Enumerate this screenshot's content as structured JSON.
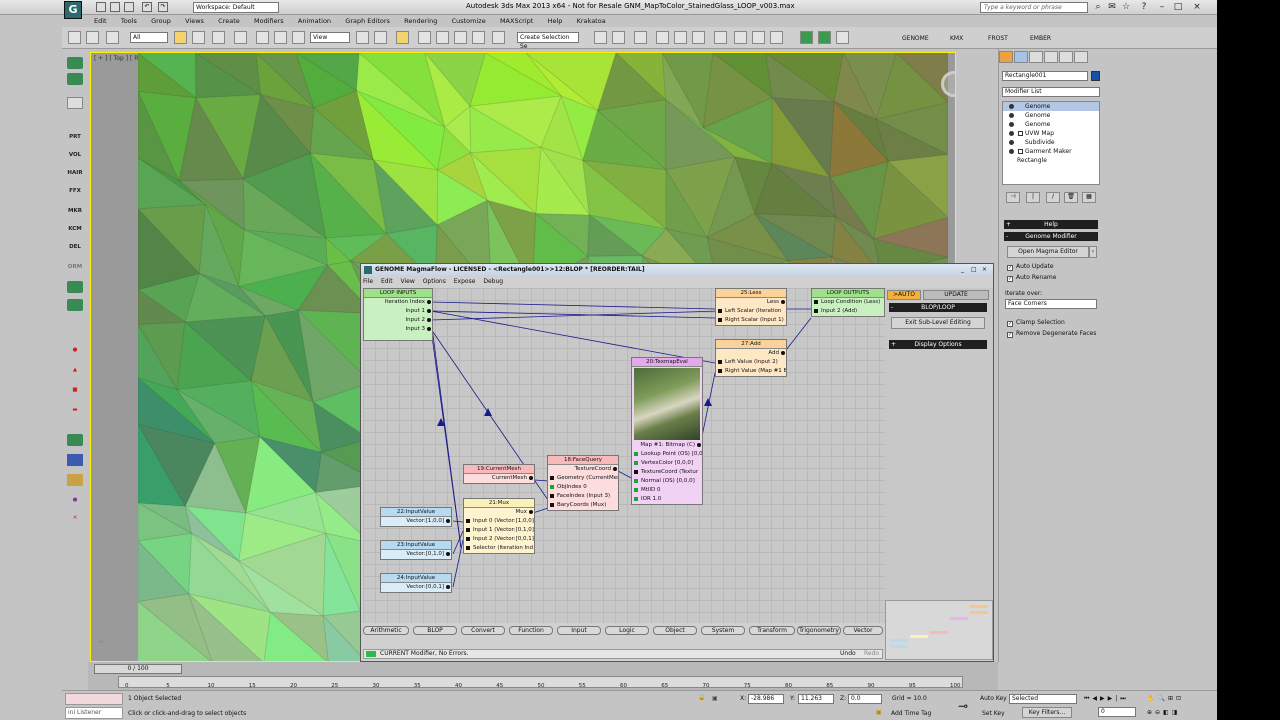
{
  "app": {
    "title": "Autodesk 3ds Max  2013 x64  - Not for Resale   GNM_MapToColor_StainedGlass_LOOP_v003.max",
    "workspace": "Workspace: Default",
    "search_placeholder": "Type a keyword or phrase",
    "menu": [
      "Edit",
      "Tools",
      "Group",
      "Views",
      "Create",
      "Modifiers",
      "Animation",
      "Graph Editors",
      "Rendering",
      "Customize",
      "MAXScript",
      "Help",
      "Krakatoa"
    ]
  },
  "toolbar": {
    "filter": "All",
    "view": "View",
    "selection_set": "Create Selection Se",
    "plugins": [
      "GENOME",
      "KMX",
      "FROST",
      "EMBER"
    ]
  },
  "leftbar": [
    "PRT",
    "VOL",
    "HAIR",
    "FFX",
    "MKR",
    "KCM",
    "DEL",
    "ORM"
  ],
  "viewport": {
    "label": "[ + ] [ Top ] [ Realistic ]"
  },
  "command_panel": {
    "object_name": "Rectangle001",
    "modifier_list": "Modifier List",
    "stack": [
      {
        "label": "Genome",
        "selected": true
      },
      {
        "label": "Genome",
        "selected": false
      },
      {
        "label": "Genome",
        "selected": false
      },
      {
        "label": "UVW Map",
        "selected": false
      },
      {
        "label": "Subdivide",
        "selected": false
      },
      {
        "label": "Garment Maker",
        "selected": false
      },
      {
        "label": "Rectangle",
        "selected": false
      }
    ],
    "help_rollout": "Help",
    "genome_rollout": "Genome Modifier",
    "open_editor": "Open Magma Editor",
    "auto_update": "Auto Update",
    "auto_rename": "Auto Rename",
    "iterate_label": "Iterate over:",
    "iterate_value": "Face Corners",
    "clamp": "Clamp Selection",
    "remove_degenerate": "Remove Degenerate Faces"
  },
  "magmaflow": {
    "title": "GENOME MagmaFlow - LICENSED - <Rectangle001>>12:BLOP *  [REORDER:TAIL]",
    "menu": [
      "File",
      "Edit",
      "View",
      "Options",
      "Expose",
      "Debug"
    ],
    "nodes": {
      "loop_inputs": {
        "title": "LOOP INPUTS",
        "outputs": [
          "Iteration Index",
          "Input 1",
          "Input 2",
          "Input 3"
        ]
      },
      "loop_outputs": {
        "title": "LOOP OUTPUTS",
        "inputs": [
          "Loop Condition (Less)",
          "Input 2 (Add)"
        ]
      },
      "less": {
        "title": "25:Less",
        "output": "Less",
        "inputs": [
          "Left Scalar (Iteration",
          "Right Scalar (Input 1)"
        ]
      },
      "add": {
        "title": "27:Add",
        "output": "Add",
        "inputs": [
          "Left Value (Input 2)",
          "Right Value (Map #1 B"
        ]
      },
      "texmap": {
        "title": "20:TexmapEval",
        "inputs": [
          "Lookup Point (OS) [0,0",
          "VertexColor [0,0,0]",
          "TextureCoord (Textur",
          "Normal (OS) [0,0,0]",
          "MtlID 0",
          "IOR 1.0"
        ],
        "output": "Map #1: Bitmap (C)"
      },
      "currentmesh": {
        "title": "19:CurrentMesh",
        "output": "CurrentMesh"
      },
      "facequery": {
        "title": "18:FaceQuery",
        "output": "TextureCoord",
        "inputs": [
          "Geometry (CurrentMes",
          "ObjIndex 0",
          "FaceIndex (Input 3)",
          "BaryCoords (Mux)"
        ]
      },
      "mux": {
        "title": "21:Mux",
        "output": "Mux",
        "inputs": [
          "Input 0 (Vector:[1,0,0]",
          "Input 1 (Vector:[0,1,0]",
          "Input 2 (Vector:[0,0,1]",
          "Selector (Iteration Ind"
        ]
      },
      "iv22": {
        "title": "22:InputValue",
        "output": "Vector:[1,0,0]"
      },
      "iv23": {
        "title": "23:InputValue",
        "output": "Vector:[0,1,0]"
      },
      "iv24": {
        "title": "24:InputValue",
        "output": "Vector:[0,0,1]"
      }
    },
    "categories": [
      "Arithmetic",
      "BLOP",
      "Convert",
      "Function",
      "Input",
      "Logic",
      "Object",
      "System",
      "Transform",
      "Trigonometry",
      "Vector"
    ],
    "status": "CURRENT Modifier, No Errors.",
    "undo": "Undo",
    "redo": "Redo",
    "side": {
      "auto": ">AUTO",
      "update": "UPDATE",
      "blop_loop": "BLOP/LOOP",
      "exit": "Exit Sub-Level Editing",
      "display": "Display Options"
    }
  },
  "timeline": {
    "slider": "0 / 100",
    "ticks": [
      "0",
      "5",
      "10",
      "15",
      "20",
      "25",
      "30",
      "35",
      "40",
      "45",
      "50",
      "55",
      "60",
      "65",
      "70",
      "75",
      "80",
      "85",
      "90",
      "95",
      "100"
    ]
  },
  "status": {
    "listener": "ini Listener",
    "selected": "1 Object Selected",
    "prompt": "Click or click-and-drag to select objects",
    "x_label": "X:",
    "x": "-28.986",
    "y_label": "Y:",
    "y": "11.263",
    "z_label": "Z:",
    "z": "0.0",
    "grid": "Grid = 10.0",
    "add_time_tag": "Add Time Tag",
    "auto_key": "Auto Key",
    "set_key": "Set Key",
    "selected_dd": "Selected",
    "key_filters": "Key Filters...",
    "frame": "0"
  }
}
